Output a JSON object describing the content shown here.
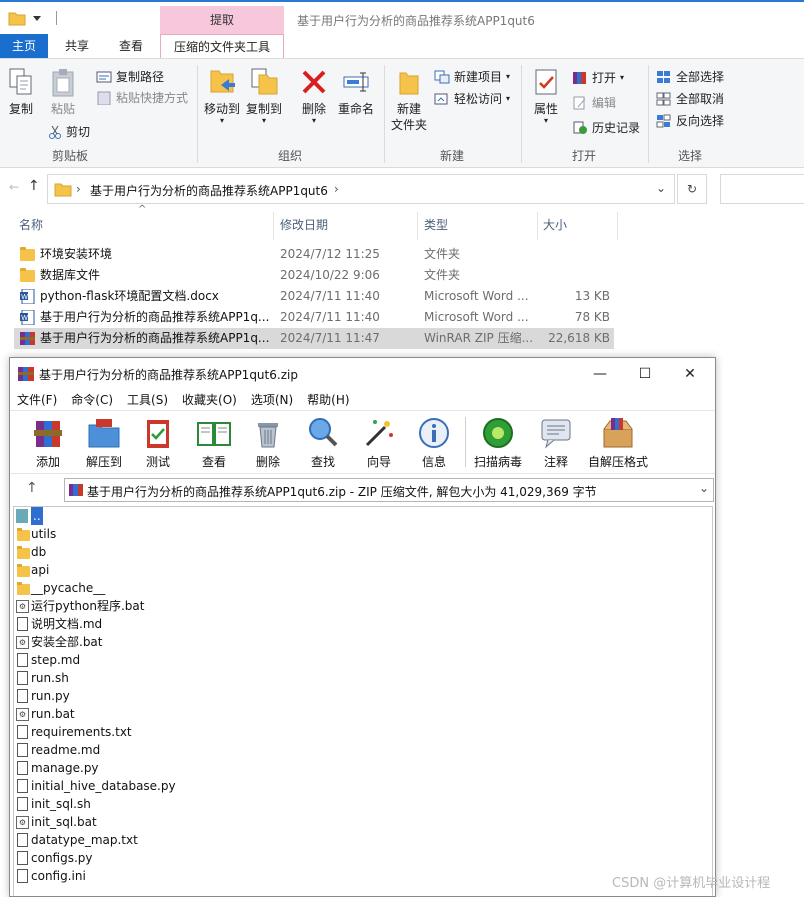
{
  "explorer": {
    "title": "基于用户行为分析的商品推荐系统APP1qut6",
    "contextual_tab_group": "提取",
    "tabs": [
      {
        "label": "主页",
        "active": true
      },
      {
        "label": "共享",
        "active": false
      },
      {
        "label": "查看",
        "active": false
      },
      {
        "label": "压缩的文件夹工具",
        "active": false
      }
    ],
    "ribbon": {
      "clipboard": {
        "group": "剪贴板",
        "copy": "复制",
        "paste": "粘贴",
        "copy_path": "复制路径",
        "paste_shortcut": "粘贴快捷方式",
        "cut": "剪切"
      },
      "organize": {
        "group": "组织",
        "move_to": "移动到",
        "copy_to": "复制到",
        "delete": "删除",
        "rename": "重命名"
      },
      "new": {
        "group": "新建",
        "new_folder_line1": "新建",
        "new_folder_line2": "文件夹",
        "new_item": "新建项目",
        "easy_access": "轻松访问"
      },
      "open": {
        "group": "打开",
        "properties": "属性",
        "open": "打开",
        "edit": "编辑",
        "history": "历史记录"
      },
      "select": {
        "group": "选择",
        "select_all": "全部选择",
        "select_none": "全部取消",
        "invert": "反向选择"
      }
    },
    "address": {
      "path": "基于用户行为分析的商品推荐系统APP1qut6"
    },
    "columns": {
      "name": "名称",
      "date": "修改日期",
      "type": "类型",
      "size": "大小"
    },
    "files": [
      {
        "name": "环境安装环境",
        "date": "2024/7/12 11:25",
        "type": "文件夹",
        "size": "",
        "icon": "folder-icon"
      },
      {
        "name": "数据库文件",
        "date": "2024/10/22 9:06",
        "type": "文件夹",
        "size": "",
        "icon": "folder-icon"
      },
      {
        "name": "python-flask环境配置文档.docx",
        "date": "2024/7/11 11:40",
        "type": "Microsoft Word ...",
        "size": "13 KB",
        "icon": "word-icon"
      },
      {
        "name": "基于用户行为分析的商品推荐系统APP1q...",
        "date": "2024/7/11 11:40",
        "type": "Microsoft Word ...",
        "size": "78 KB",
        "icon": "word-icon"
      },
      {
        "name": "基于用户行为分析的商品推荐系统APP1q...",
        "date": "2024/7/11 11:47",
        "type": "WinRAR ZIP 压缩...",
        "size": "22,618 KB",
        "icon": "winrar-icon"
      }
    ]
  },
  "winrar": {
    "title": "基于用户行为分析的商品推荐系统APP1qut6.zip",
    "menus": [
      "文件(F)",
      "命令(C)",
      "工具(S)",
      "收藏夹(O)",
      "选项(N)",
      "帮助(H)"
    ],
    "toolbar": [
      "添加",
      "解压到",
      "测试",
      "查看",
      "删除",
      "查找",
      "向导",
      "信息",
      "扫描病毒",
      "注释",
      "自解压格式"
    ],
    "path_text": "基于用户行为分析的商品推荐系统APP1qut6.zip - ZIP 压缩文件, 解包大小为 41,029,369 字节",
    "entries": [
      {
        "name": "..",
        "kind": "up"
      },
      {
        "name": "utils",
        "kind": "folder"
      },
      {
        "name": "db",
        "kind": "folder"
      },
      {
        "name": "api",
        "kind": "folder"
      },
      {
        "name": "__pycache__",
        "kind": "folder"
      },
      {
        "name": "运行python程序.bat",
        "kind": "bat"
      },
      {
        "name": "说明文档.md",
        "kind": "file"
      },
      {
        "name": "安装全部.bat",
        "kind": "bat"
      },
      {
        "name": "step.md",
        "kind": "file"
      },
      {
        "name": "run.sh",
        "kind": "file"
      },
      {
        "name": "run.py",
        "kind": "file"
      },
      {
        "name": "run.bat",
        "kind": "bat"
      },
      {
        "name": "requirements.txt",
        "kind": "file"
      },
      {
        "name": "readme.md",
        "kind": "file"
      },
      {
        "name": "manage.py",
        "kind": "file"
      },
      {
        "name": "initial_hive_database.py",
        "kind": "file"
      },
      {
        "name": "init_sql.sh",
        "kind": "file"
      },
      {
        "name": "init_sql.bat",
        "kind": "bat"
      },
      {
        "name": "datatype_map.txt",
        "kind": "file"
      },
      {
        "name": "configs.py",
        "kind": "file"
      },
      {
        "name": "config.ini",
        "kind": "file"
      }
    ]
  },
  "watermark": "CSDN @计算机毕业设计程"
}
